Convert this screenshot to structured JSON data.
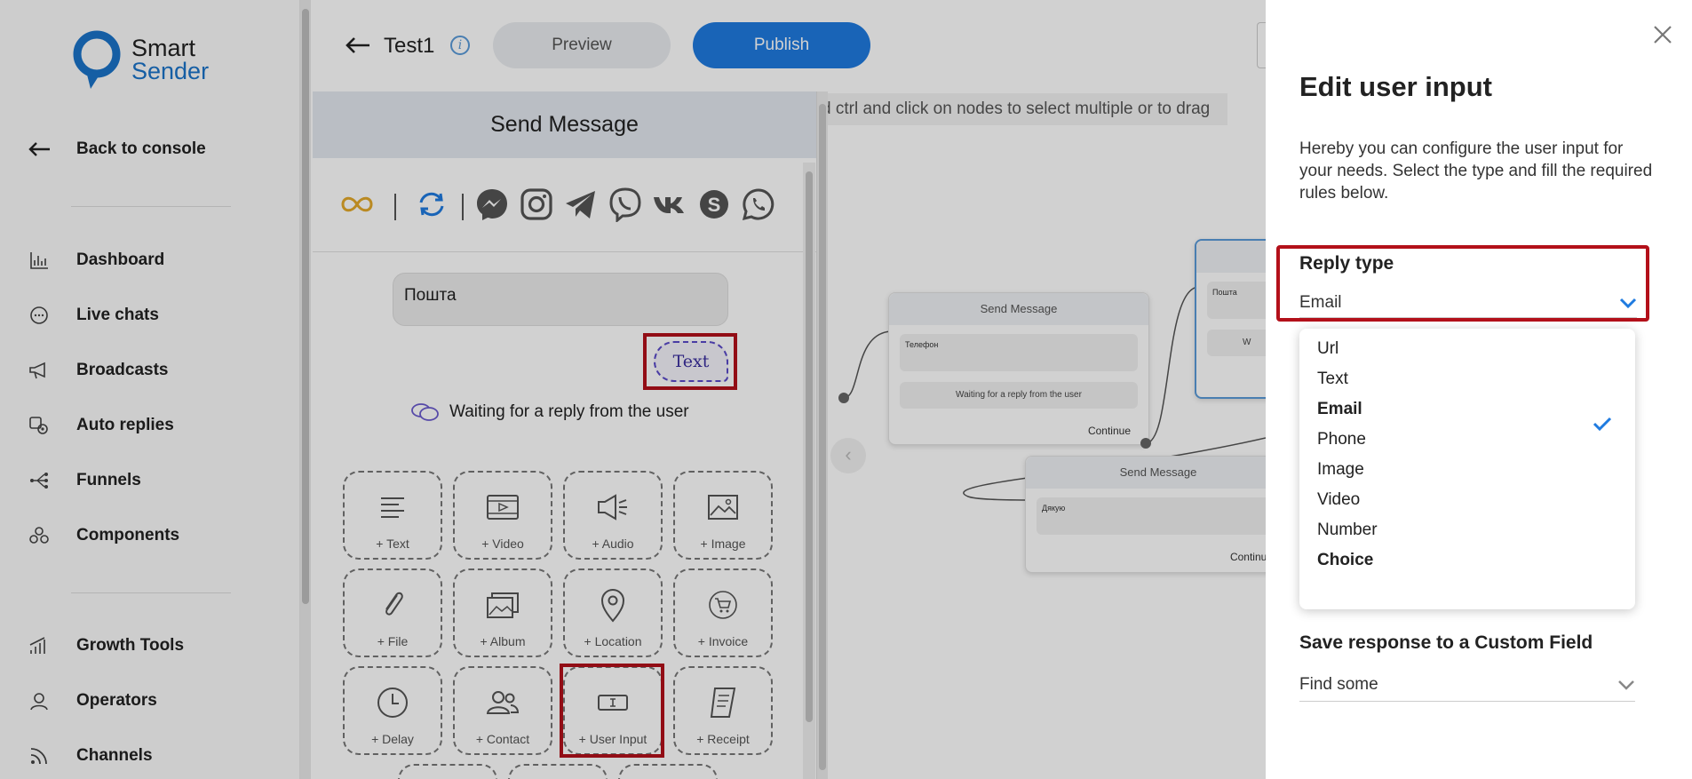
{
  "brand": {
    "line1": "Smart",
    "line2": "Sender",
    "accent": "#1a73c9"
  },
  "sidebar": {
    "back_label": "Back to console",
    "items": [
      {
        "label": "Dashboard",
        "icon": "bar-chart-icon"
      },
      {
        "label": "Live chats",
        "icon": "chat-bubble-icon"
      },
      {
        "label": "Broadcasts",
        "icon": "megaphone-icon"
      },
      {
        "label": "Auto replies",
        "icon": "auto-reply-icon"
      },
      {
        "label": "Funnels",
        "icon": "funnel-icon"
      },
      {
        "label": "Components",
        "icon": "components-icon"
      }
    ],
    "items2": [
      {
        "label": "Growth Tools",
        "icon": "growth-chart-icon"
      },
      {
        "label": "Operators",
        "icon": "operator-icon"
      },
      {
        "label": "Channels",
        "icon": "rss-icon"
      }
    ]
  },
  "topbar": {
    "title": "Test1",
    "preview_label": "Preview",
    "publish_label": "Publish",
    "publish_color": "#1f7be0"
  },
  "canvas": {
    "hint": "d ctrl and click on nodes to select multiple or to drag",
    "nodes": [
      {
        "title": "Send Message",
        "text": "Телефон",
        "waiting": "Waiting for a reply from the user",
        "continue": "Continue"
      },
      {
        "title": "Send Message",
        "text": "Дякую",
        "continue": "Continue"
      },
      {
        "text": "Пошта",
        "waiting_partial": "W"
      }
    ]
  },
  "send_message": {
    "header": "Send Message",
    "message_text": "Пошта",
    "reply_tag": "Text",
    "waiting": "Waiting for a reply from the user",
    "blocks": [
      {
        "label": "+ Text",
        "icon": "text-lines-icon"
      },
      {
        "label": "+ Video",
        "icon": "video-icon"
      },
      {
        "label": "+ Audio",
        "icon": "audio-speaker-icon"
      },
      {
        "label": "+ Image",
        "icon": "image-icon"
      },
      {
        "label": "+ File",
        "icon": "paperclip-icon"
      },
      {
        "label": "+ Album",
        "icon": "album-icon"
      },
      {
        "label": "+ Location",
        "icon": "location-pin-icon"
      },
      {
        "label": "+ Invoice",
        "icon": "cart-icon"
      },
      {
        "label": "+ Delay",
        "icon": "clock-icon"
      },
      {
        "label": "+ Contact",
        "icon": "contact-icon"
      },
      {
        "label": "+ User Input",
        "icon": "text-cursor-icon"
      },
      {
        "label": "+ Receipt",
        "icon": "receipt-icon"
      }
    ]
  },
  "drawer": {
    "title": "Edit user input",
    "description": "Hereby you can configure the user input for your needs. Select the type and fill the required rules below.",
    "reply_type_label": "Reply type",
    "reply_type_value": "Email",
    "options": [
      "Url",
      "Text",
      "Email",
      "Phone",
      "Image",
      "Video",
      "Number",
      "Choice"
    ],
    "selected_option": "Email",
    "save_label": "Save response to a Custom Field",
    "find_placeholder": "Find some"
  }
}
